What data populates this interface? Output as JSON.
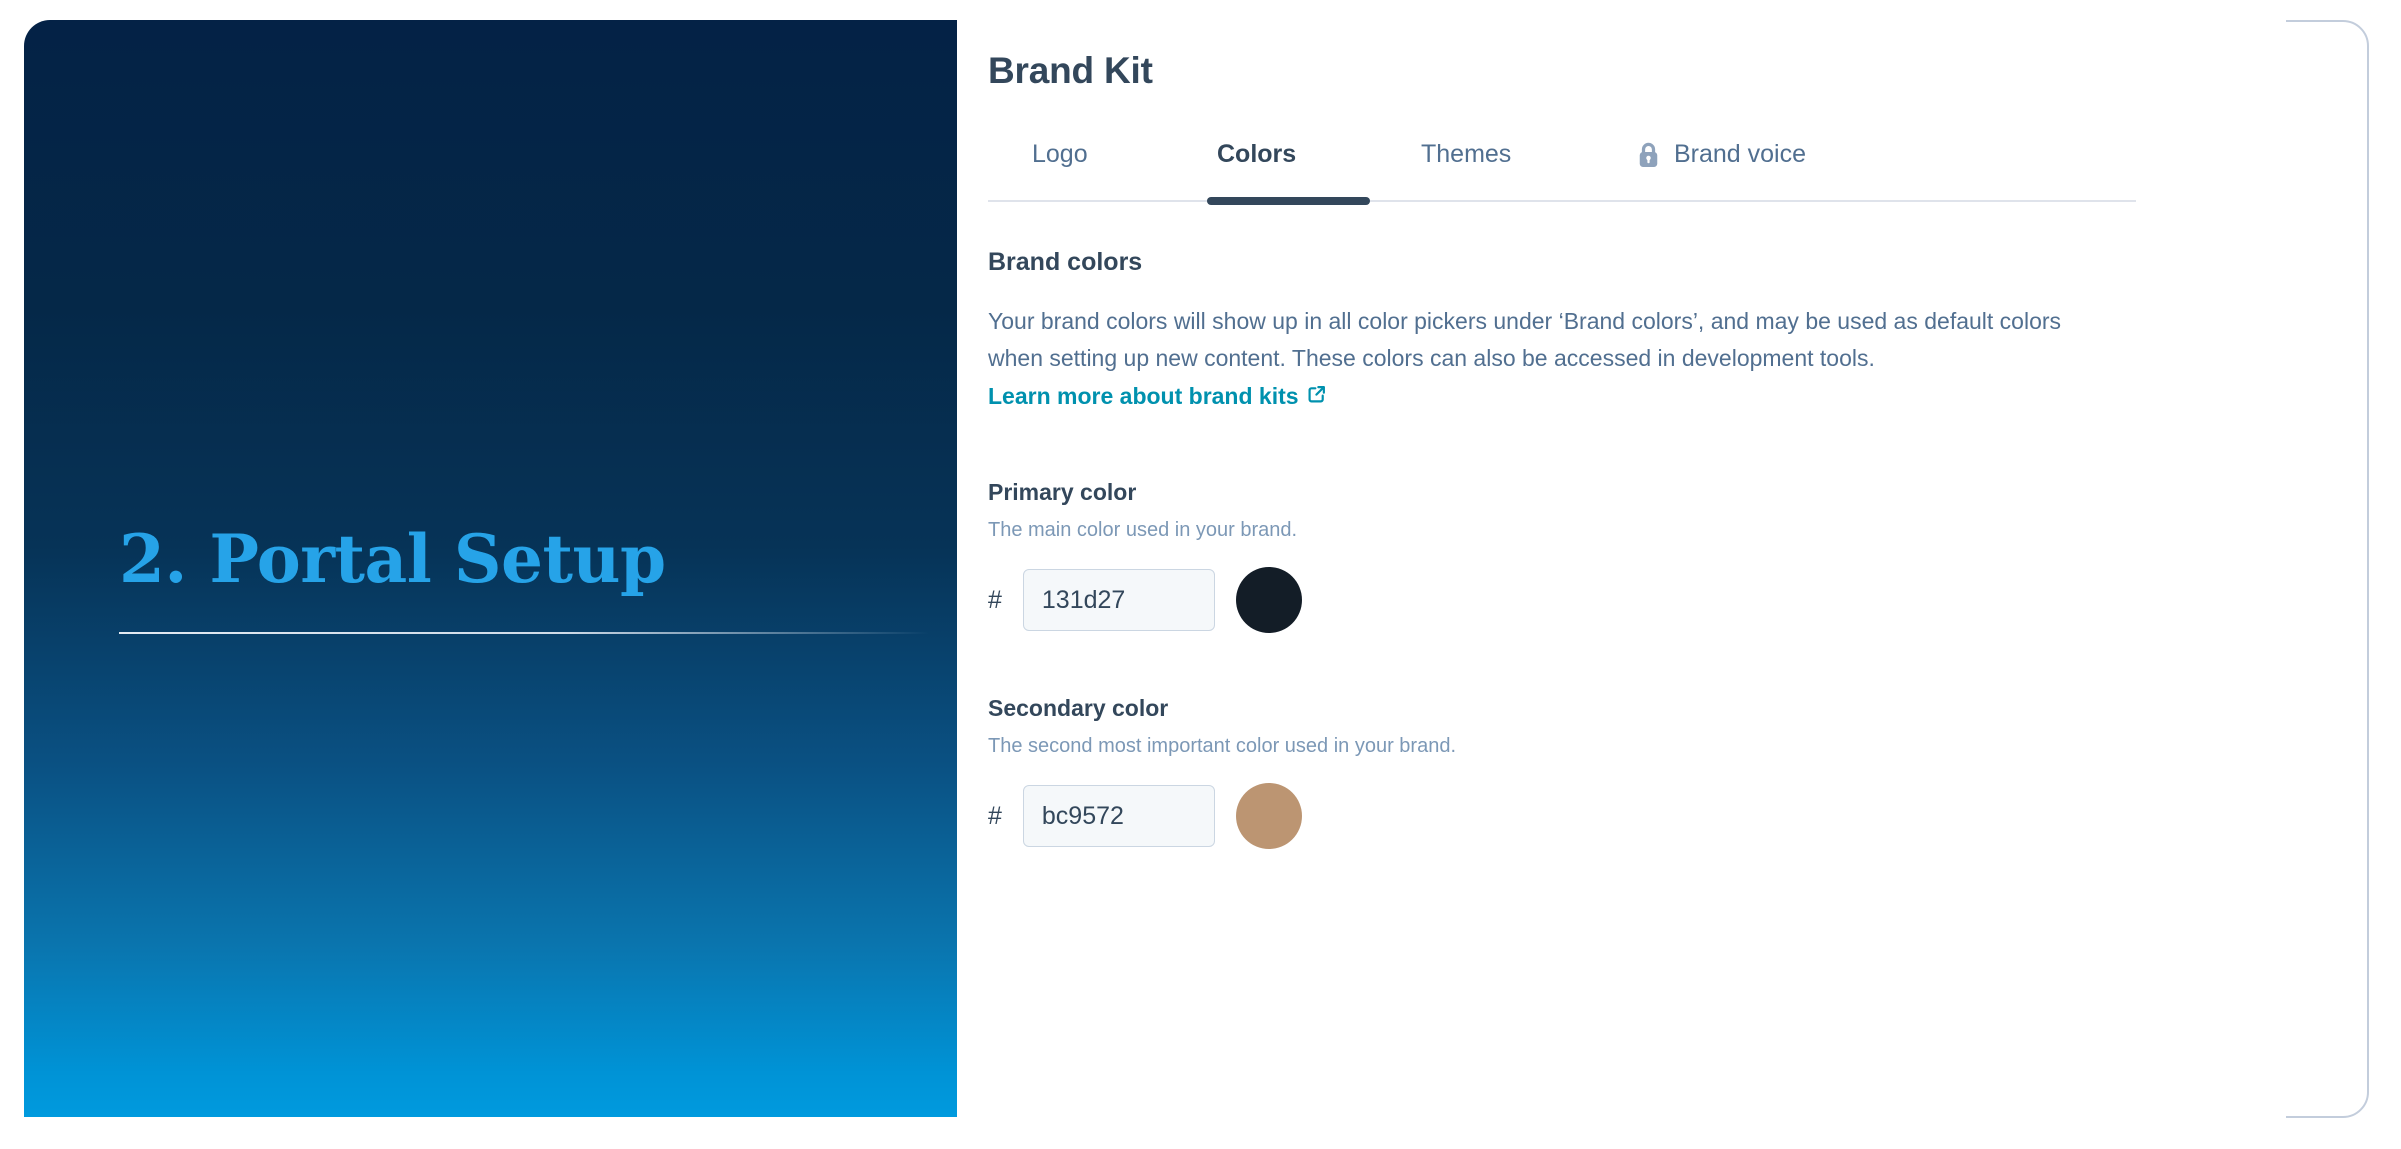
{
  "slide": {
    "hero": {
      "title": "2. Portal Setup",
      "title_color": "#26a3e8",
      "gradient_top": "#042246",
      "gradient_bottom": "#009ade"
    }
  },
  "page": {
    "title": "Brand Kit"
  },
  "tabs": {
    "items": [
      {
        "label": "Logo",
        "active": false,
        "locked": false
      },
      {
        "label": "Colors",
        "active": true,
        "locked": false
      },
      {
        "label": "Themes",
        "active": false,
        "locked": false
      },
      {
        "label": "Brand voice",
        "active": false,
        "locked": true,
        "icon": "lock-icon"
      }
    ],
    "active_underline_color": "#33475b"
  },
  "section": {
    "heading": "Brand colors",
    "description_before_link": "Your brand colors will show up in all color pickers under ‘Brand colors’, and may be used as default colors when setting up new content. These colors can also be accessed in development tools.",
    "link_label": "Learn more about brand kits",
    "link_icon": "external-link-icon",
    "link_color": "#0091ae"
  },
  "fields": [
    {
      "label": "Primary color",
      "help": "The main color used in your brand.",
      "hash": "#",
      "value": "131d27",
      "placeholder": "131d27",
      "swatch_color": "#131d27"
    },
    {
      "label": "Secondary color",
      "help": "The second most important color used in your brand.",
      "hash": "#",
      "value": "bc9572",
      "placeholder": "bc9572",
      "swatch_color": "#bc9572"
    }
  ]
}
